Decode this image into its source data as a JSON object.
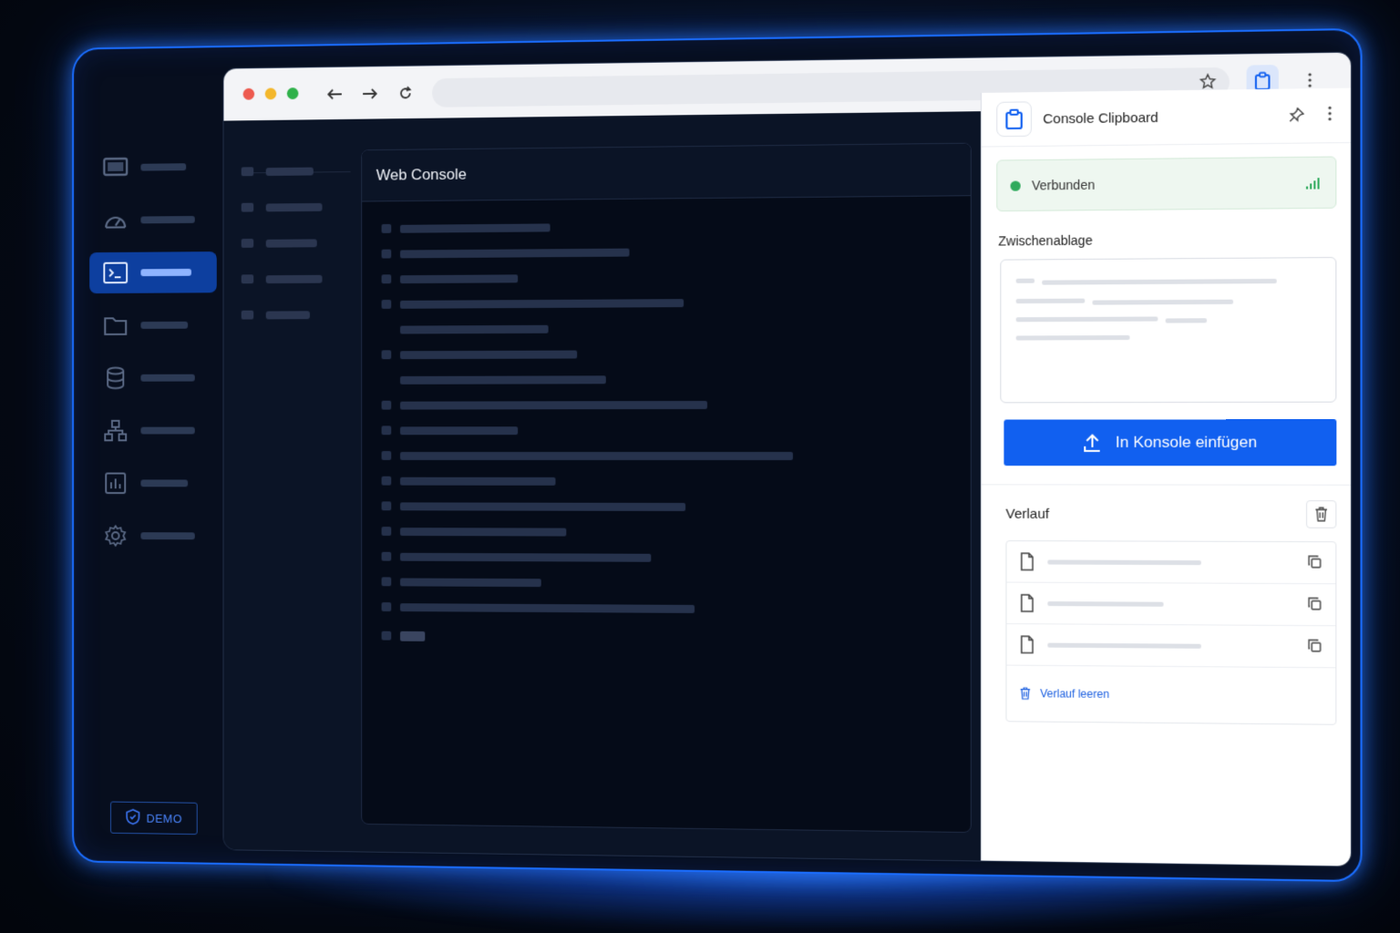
{
  "browser": {
    "traffic_lights": [
      "#ed5a4f",
      "#f3b72c",
      "#2fb14a"
    ],
    "accent": "#1160f0"
  },
  "rail": {
    "items": [
      {
        "icon": "monitor-icon",
        "active": false
      },
      {
        "icon": "gauge-icon",
        "active": false
      },
      {
        "icon": "terminal-icon",
        "active": true
      },
      {
        "icon": "folder-icon",
        "active": false
      },
      {
        "icon": "database-icon",
        "active": false
      },
      {
        "icon": "network-icon",
        "active": false
      },
      {
        "icon": "chart-icon",
        "active": false
      },
      {
        "icon": "gear-icon",
        "active": false
      }
    ],
    "badge_label": "DEMO"
  },
  "console": {
    "title": "Web Console"
  },
  "extension": {
    "title": "Console Clipboard",
    "status_text": "Verbunden",
    "status_color": "#2faa5c",
    "clipboard_label": "Zwischenablage",
    "paste_button_label": "In Konsole einfügen",
    "history_title": "Verlauf",
    "clear_history_label": "Verlauf leeren"
  }
}
